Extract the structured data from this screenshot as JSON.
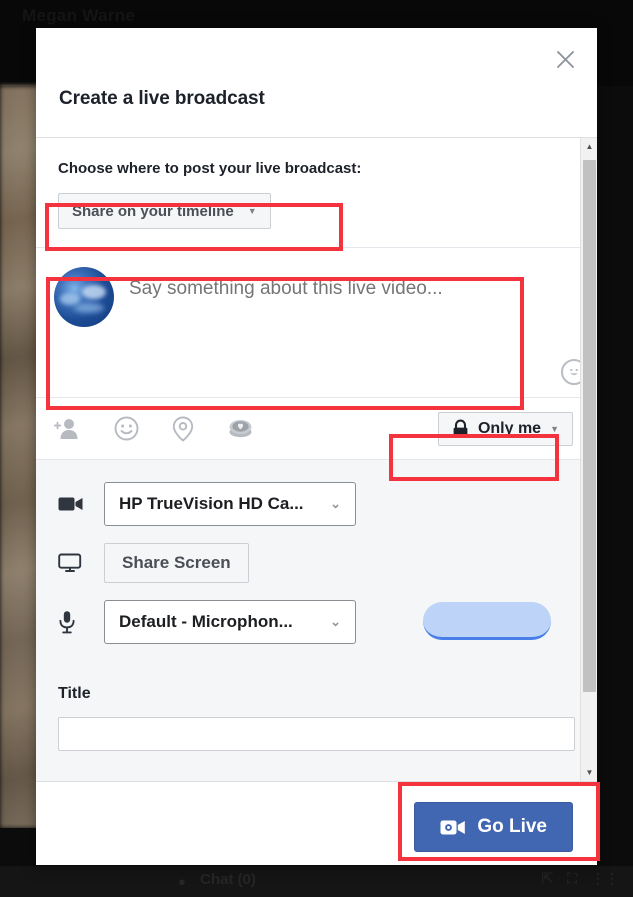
{
  "background": {
    "user_name": "Megan Warne",
    "chat_label": "Chat (0)",
    "chat_icon": "chat-bubble-icon",
    "right_icons": [
      "share-icon",
      "fullscreen-icon",
      "more-icon"
    ]
  },
  "modal": {
    "title": "Create a live broadcast",
    "close_icon": "close-icon",
    "close_glyph": "✕"
  },
  "post_section": {
    "label": "Choose where to post your live broadcast:",
    "destination_value": "Share on your timeline",
    "destination_options": [
      "Share on your timeline"
    ],
    "caret_glyph": "▼",
    "caret_icon": "chevron-down-icon"
  },
  "composer": {
    "avatar_icon": "user-avatar",
    "placeholder": "Say something about this live video...",
    "value": "",
    "emoji_icon": "emoji-smiley-icon",
    "emoji_glyph": "☺"
  },
  "toolbar": {
    "icons": [
      {
        "name": "tag-people-icon",
        "label": "Tag people"
      },
      {
        "name": "feeling-activity-icon",
        "label": "Feeling/Activity"
      },
      {
        "name": "check-in-location-icon",
        "label": "Check in"
      },
      {
        "name": "donate-fundraiser-icon",
        "label": "Support nonprofit"
      }
    ],
    "privacy_value": "Only me",
    "privacy_icon": "lock-icon",
    "privacy_caret_glyph": "▼"
  },
  "devices": {
    "camera_icon": "video-camera-icon",
    "camera_value": "HP TrueVision HD Ca...",
    "screen_icon": "monitor-icon",
    "share_screen_label": "Share Screen",
    "mic_icon": "microphone-icon",
    "mic_value": "Default - Microphon...",
    "audio_meter_name": "audio-level-meter",
    "caret_glyph": "⌄"
  },
  "title_field": {
    "label": "Title",
    "value": "",
    "placeholder": ""
  },
  "scrollbar": {
    "up_glyph": "▲",
    "down_glyph": "▼"
  },
  "footer": {
    "go_live_label": "Go Live",
    "go_live_icon": "video-camera-icon"
  },
  "colors": {
    "brand_blue": "#4267B2",
    "annotation_red": "#F5333F",
    "panel_gray": "#F5F6F7",
    "border_gray": "#CCD0D5",
    "text_dark": "#1D2129",
    "text_muted": "#8D949E",
    "audio_meter_blue": "#BDD3F7"
  }
}
